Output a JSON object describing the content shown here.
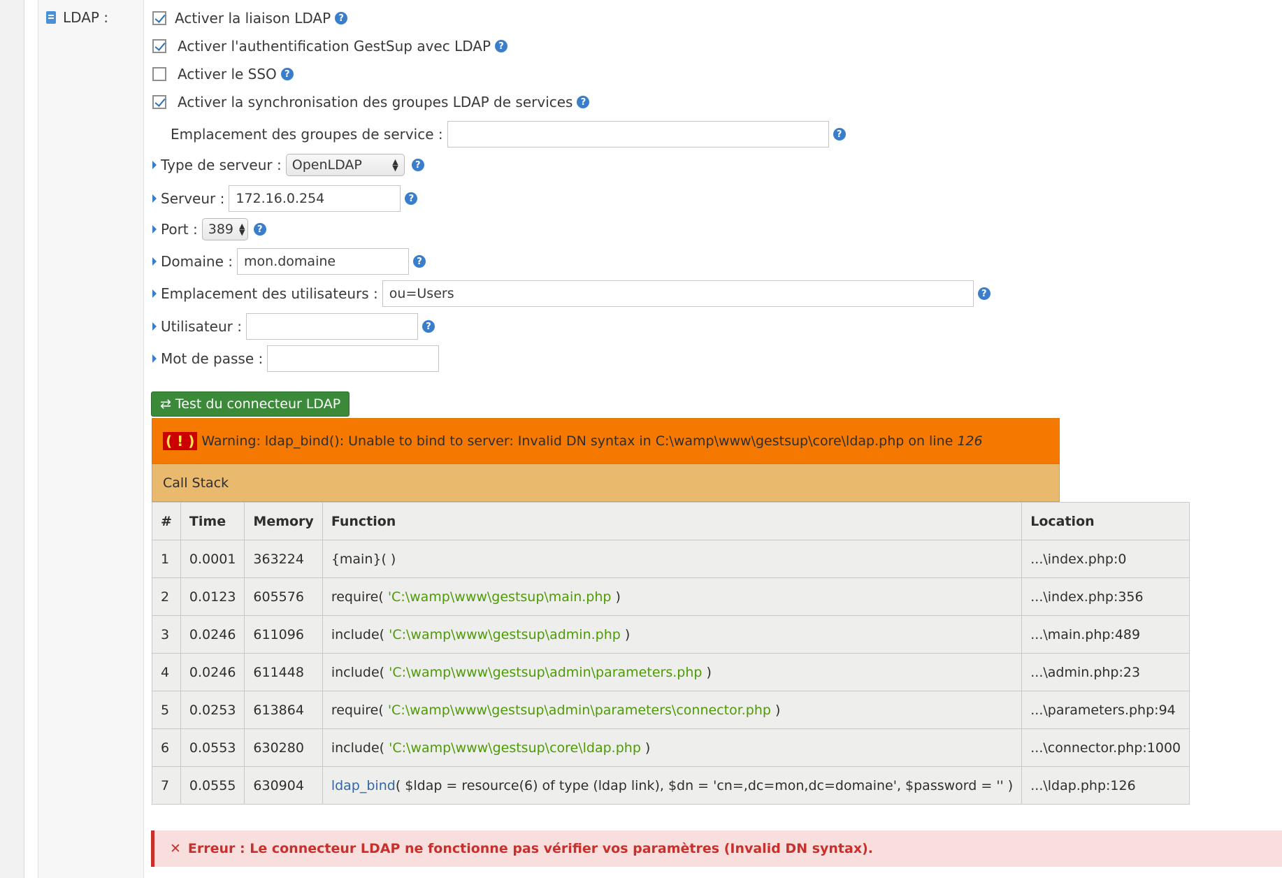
{
  "section_label": "LDAP :",
  "checkboxes": [
    {
      "label": "Activer la liaison LDAP",
      "checked": true
    },
    {
      "label": "Activer l'authentification GestSup avec LDAP",
      "checked": true
    },
    {
      "label": "Activer le SSO",
      "checked": false
    },
    {
      "label": "Activer la synchronisation des groupes LDAP de services",
      "checked": true
    }
  ],
  "help_glyph": "?",
  "fields": {
    "service_groups": {
      "label": "Emplacement des groupes de service :",
      "value": ""
    },
    "server_type": {
      "label": "Type de serveur :",
      "value": "OpenLDAP"
    },
    "server": {
      "label": "Serveur :",
      "value": "172.16.0.254"
    },
    "port": {
      "label": "Port :",
      "value": "389"
    },
    "domain": {
      "label": "Domaine :",
      "value": "mon.domaine"
    },
    "users_location": {
      "label": "Emplacement des utilisateurs :",
      "value": "ou=Users"
    },
    "user": {
      "label": "Utilisateur :",
      "value": ""
    },
    "password": {
      "label": "Mot de passe :",
      "value": ""
    }
  },
  "test_button": {
    "icon": "⇄",
    "label": "Test du connecteur LDAP"
  },
  "warning": {
    "badge": "( ! )",
    "message": "Warning: ldap_bind(): Unable to bind to server: Invalid DN syntax in C:\\wamp\\www\\gestsup\\core\\ldap.php on line",
    "line": "126"
  },
  "call_stack": {
    "title": "Call Stack",
    "columns": [
      "#",
      "Time",
      "Memory",
      "Function",
      "Location"
    ],
    "rows": [
      {
        "n": "1",
        "time": "0.0001",
        "memory": "363224",
        "fn": "{main}( )",
        "arg": "",
        "fn_end": "",
        "location": "...\\index.php:0"
      },
      {
        "n": "2",
        "time": "0.0123",
        "memory": "605576",
        "fn": "require( ",
        "arg": "'C:\\wamp\\www\\gestsup\\main.php",
        "fn_end": " )",
        "location": "...\\index.php:356"
      },
      {
        "n": "3",
        "time": "0.0246",
        "memory": "611096",
        "fn": "include( ",
        "arg": "'C:\\wamp\\www\\gestsup\\admin.php",
        "fn_end": " )",
        "location": "...\\main.php:489"
      },
      {
        "n": "4",
        "time": "0.0246",
        "memory": "611448",
        "fn": "include( ",
        "arg": "'C:\\wamp\\www\\gestsup\\admin\\parameters.php",
        "fn_end": " )",
        "location": "...\\admin.php:23"
      },
      {
        "n": "5",
        "time": "0.0253",
        "memory": "613864",
        "fn": "require( ",
        "arg": "'C:\\wamp\\www\\gestsup\\admin\\parameters\\connector.php",
        "fn_end": " )",
        "location": "...\\parameters.php:94"
      },
      {
        "n": "6",
        "time": "0.0553",
        "memory": "630280",
        "fn": "include( ",
        "arg": "'C:\\wamp\\www\\gestsup\\core\\ldap.php",
        "fn_end": " )",
        "location": "...\\connector.php:1000"
      },
      {
        "n": "7",
        "time": "0.0555",
        "memory": "630904",
        "fn_link": "ldap_bind",
        "fn": "( $ldap = resource(6) of type (ldap link), $dn = 'cn=,dc=mon,dc=domaine', $password = '' )",
        "arg": "",
        "fn_end": "",
        "location": "...\\ldap.php:126"
      }
    ]
  },
  "error_alert": {
    "icon": "✕",
    "message": "Erreur : Le connecteur LDAP ne fonctionne pas vérifier vos paramètres (Invalid DN syntax)."
  },
  "colors": {
    "warning_orange": "#f57900",
    "callstack_tan": "#e9b96e",
    "success_green": "#3a8a3a",
    "error_red": "#c9302c",
    "help_blue": "#3a7ecb"
  }
}
